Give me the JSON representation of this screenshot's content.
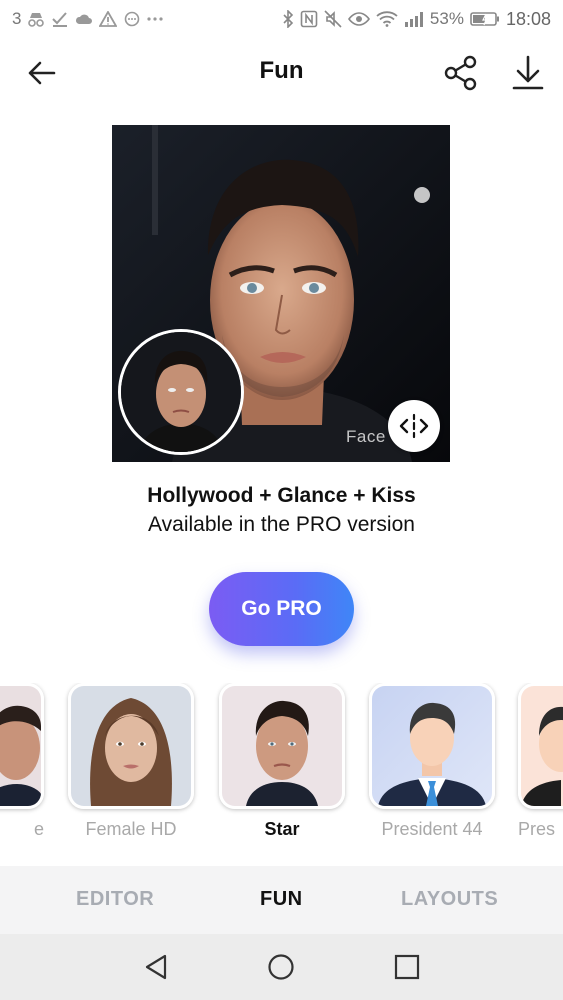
{
  "status_bar": {
    "notif_count": "3",
    "battery": "53%",
    "time": "18:08"
  },
  "header": {
    "title": "Fun"
  },
  "photo": {
    "watermark": "Face"
  },
  "caption": {
    "title": "Hollywood + Glance + Kiss",
    "subtitle": "Available in the PRO version"
  },
  "cta": {
    "label": "Go PRO"
  },
  "filters": [
    {
      "label": "e"
    },
    {
      "label": "Female HD"
    },
    {
      "label": "Star"
    },
    {
      "label": "President 44"
    },
    {
      "label": "Pres"
    }
  ],
  "tabs": {
    "editor": "EDITOR",
    "fun": "FUN",
    "layouts": "LAYOUTS"
  },
  "colors": {
    "accent_start": "#7b5cf3",
    "accent_end": "#3f86f7",
    "active_tab": "#111111",
    "inactive_tab": "#a8acb3"
  }
}
